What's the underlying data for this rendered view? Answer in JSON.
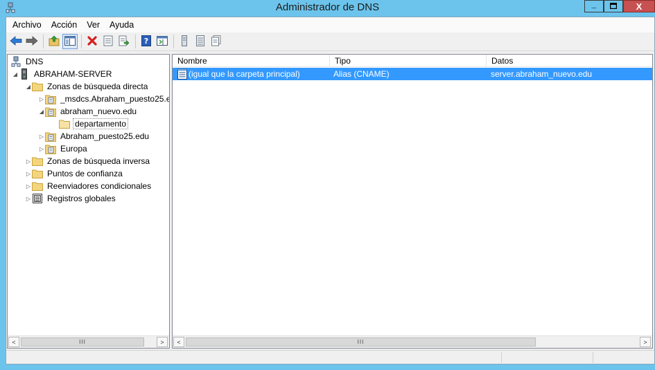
{
  "window": {
    "title": "Administrador de DNS",
    "minimize_glyph": "_",
    "maximize_glyph": "□",
    "close_glyph": "X"
  },
  "menu": {
    "items": [
      "Archivo",
      "Acción",
      "Ver",
      "Ayuda"
    ]
  },
  "toolbar": {
    "buttons": [
      "back-icon",
      "forward-icon",
      "up-folder-icon",
      "show-hide-tree-icon",
      "delete-icon",
      "properties-icon",
      "export-list-icon",
      "help-icon",
      "console-icon",
      "server-icon",
      "list-icon",
      "records-icon"
    ]
  },
  "tree": {
    "items": [
      {
        "label": "DNS",
        "icon": "dns-root-icon"
      },
      {
        "label": "ABRAHAM-SERVER",
        "icon": "server-icon",
        "expanded": true
      },
      {
        "label": "Zonas de búsqueda directa",
        "icon": "folder-icon",
        "expanded": true
      },
      {
        "label": "_msdcs.Abraham_puesto25.e",
        "icon": "zone-icon",
        "expanded": false
      },
      {
        "label": "abraham_nuevo.edu",
        "icon": "zone-icon",
        "expanded": true
      },
      {
        "label": "departamento",
        "icon": "folder-icon",
        "selected": true
      },
      {
        "label": "Abraham_puesto25.edu",
        "icon": "zone-icon",
        "expanded": false
      },
      {
        "label": "Europa",
        "icon": "zone-icon",
        "expanded": false
      },
      {
        "label": "Zonas de búsqueda inversa",
        "icon": "folder-icon",
        "expanded": false
      },
      {
        "label": "Puntos de confianza",
        "icon": "folder-icon",
        "expanded": false
      },
      {
        "label": "Reenviadores condicionales",
        "icon": "folder-icon",
        "expanded": false
      },
      {
        "label": "Registros globales",
        "icon": "global-records-icon",
        "expanded": false
      }
    ]
  },
  "list": {
    "columns": [
      "Nombre",
      "Tipo",
      "Datos"
    ],
    "rows": [
      {
        "nombre": "(igual que la carpeta principal)",
        "tipo": "Alias (CNAME)",
        "datos": "server.abraham_nuevo.edu",
        "selected": true
      }
    ]
  },
  "scrollbar": {
    "left_arrow": "<",
    "right_arrow": ">",
    "thumb_grip": "III"
  },
  "colors": {
    "titlebar": "#6cc4ec",
    "selection": "#3399ff",
    "close_button": "#c75050"
  }
}
